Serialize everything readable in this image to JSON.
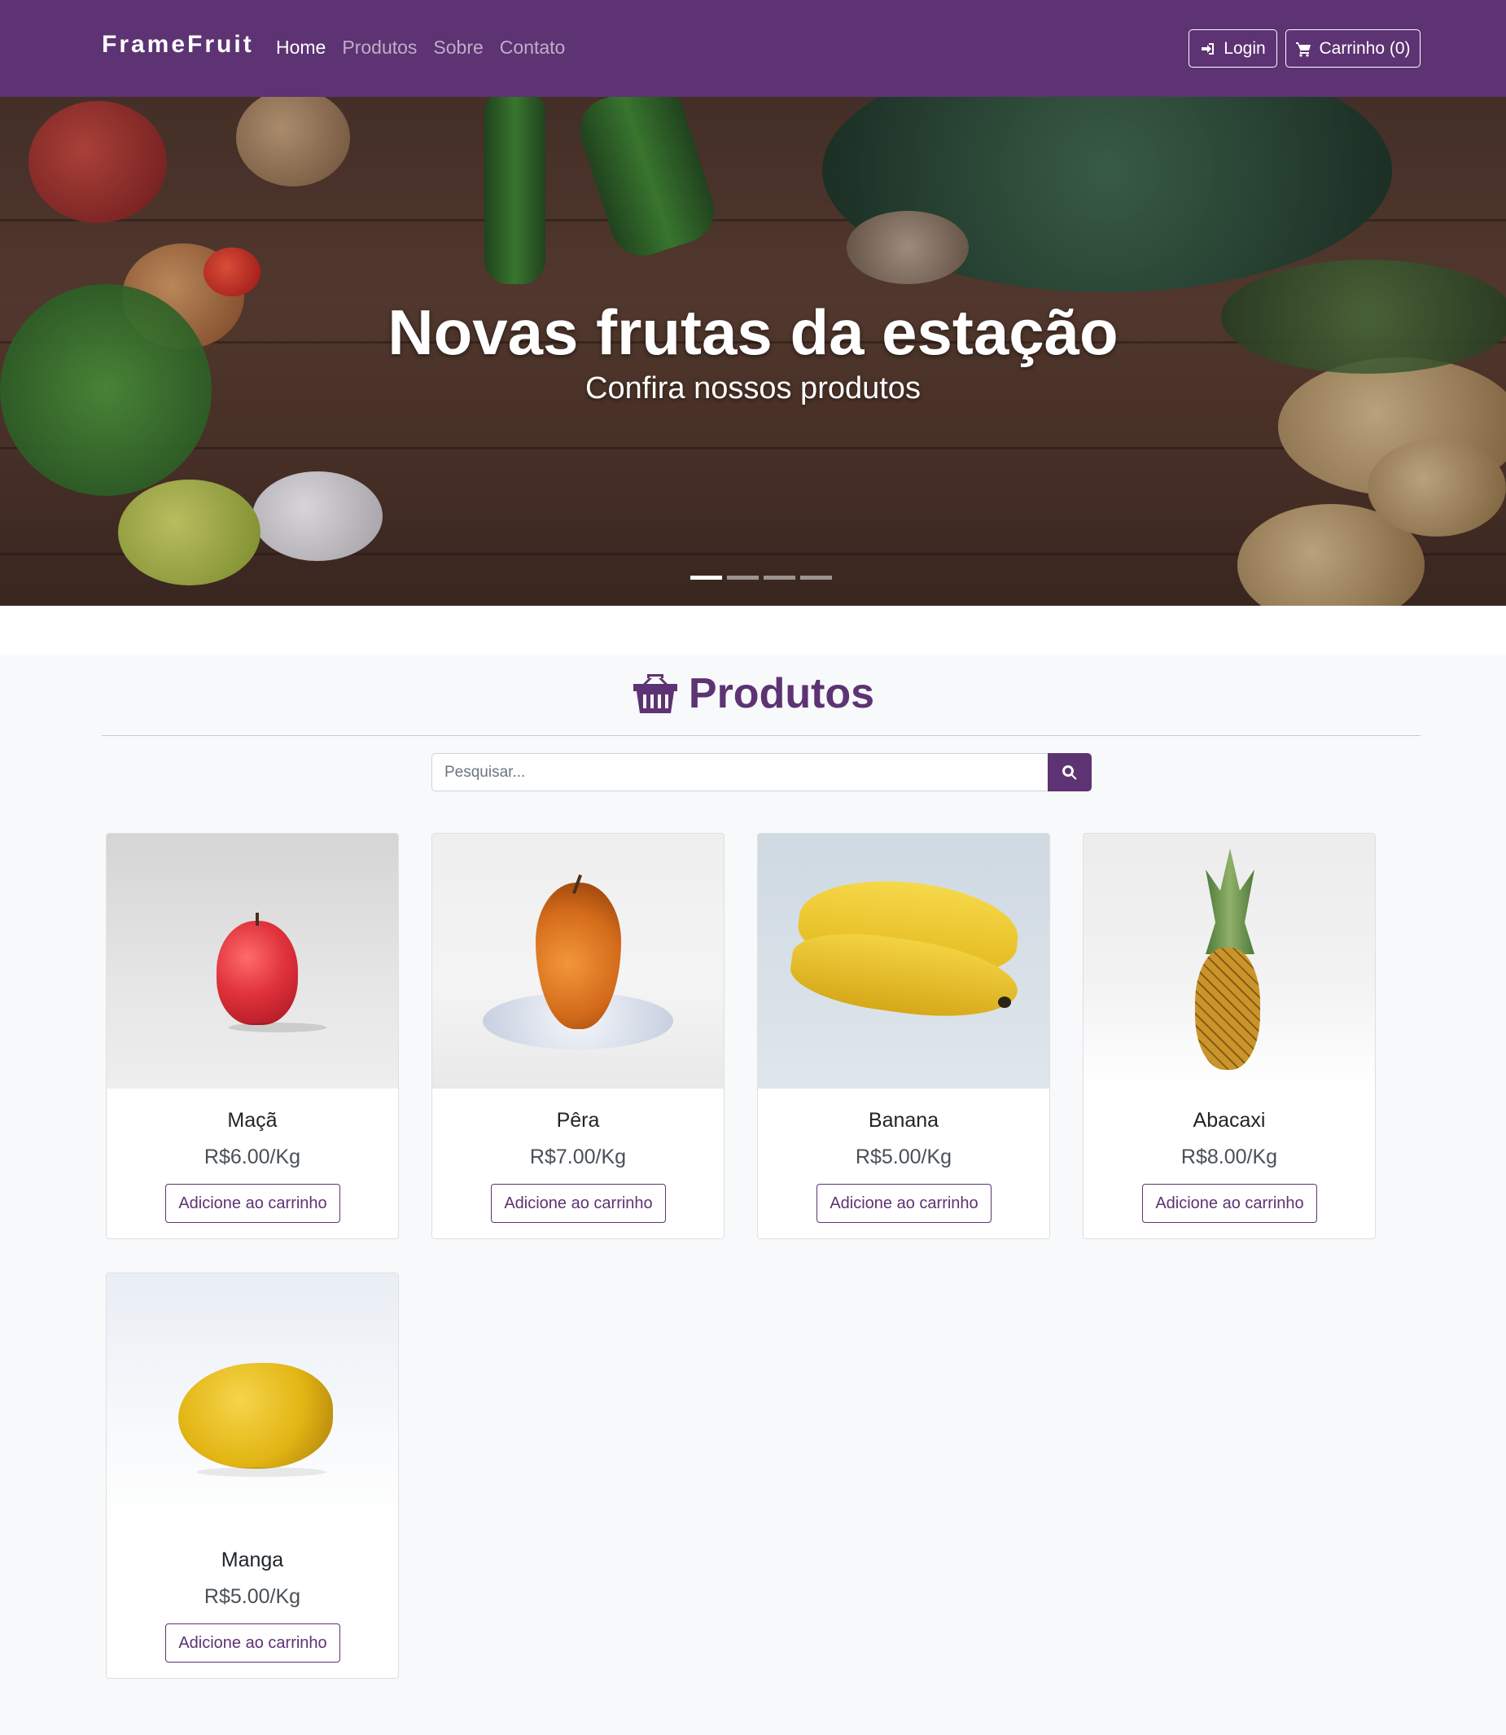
{
  "navbar": {
    "brand": "FrameFruit",
    "links": [
      {
        "label": "Home",
        "active": true
      },
      {
        "label": "Produtos",
        "active": false
      },
      {
        "label": "Sobre",
        "active": false
      },
      {
        "label": "Contato",
        "active": false
      }
    ],
    "login_label": "Login",
    "cart_label": "Carrinho (0)",
    "login_icon": "sign-in-icon",
    "cart_icon": "cart-icon",
    "background_color": "#5d3373"
  },
  "hero": {
    "title": "Novas frutas da estação",
    "subtitle": "Confira nossos produtos",
    "slides_count": 4,
    "active_slide": 1
  },
  "products": {
    "title": "Produtos",
    "title_icon": "basket-icon",
    "search": {
      "placeholder": "Pesquisar...",
      "value": "",
      "button_icon": "search-icon"
    },
    "items": [
      {
        "name": "Maçã",
        "price": "R$6.00/Kg",
        "button": "Adicione ao carrinho",
        "image": "apple"
      },
      {
        "name": "Pêra",
        "price": "R$7.00/Kg",
        "button": "Adicione ao carrinho",
        "image": "pear"
      },
      {
        "name": "Banana",
        "price": "R$5.00/Kg",
        "button": "Adicione ao carrinho",
        "image": "banana"
      },
      {
        "name": "Abacaxi",
        "price": "R$8.00/Kg",
        "button": "Adicione ao carrinho",
        "image": "pineapple"
      },
      {
        "name": "Manga",
        "price": "R$5.00/Kg",
        "button": "Adicione ao carrinho",
        "image": "mango"
      }
    ]
  },
  "colors": {
    "accent": "#5d3373",
    "section_bg": "#f8f9fa"
  }
}
